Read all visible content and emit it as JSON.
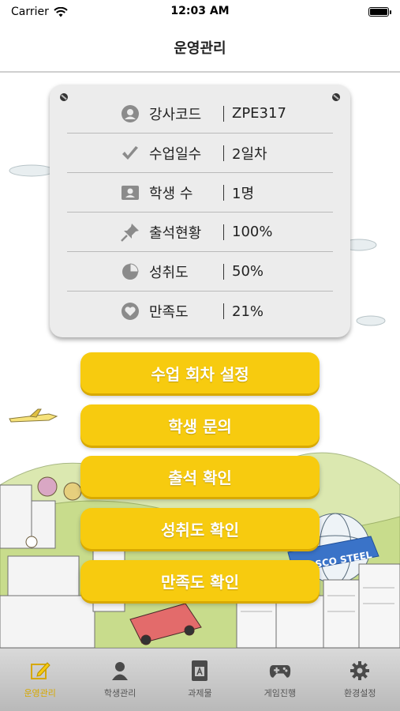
{
  "status_bar": {
    "carrier": "Carrier",
    "time": "12:03 AM"
  },
  "nav": {
    "title": "운영관리"
  },
  "info": {
    "rows": [
      {
        "label": "강사코드",
        "value": "ZPE317",
        "icon": "user-circle-icon"
      },
      {
        "label": "수업일수",
        "value": "2일차",
        "icon": "checkmark-icon"
      },
      {
        "label": "학생 수",
        "value": "1명",
        "icon": "id-card-icon"
      },
      {
        "label": "출석현황",
        "value": "100%",
        "icon": "pushpin-icon"
      },
      {
        "label": "성취도",
        "value": "50%",
        "icon": "pie-chart-icon"
      },
      {
        "label": "만족도",
        "value": "21%",
        "icon": "heart-circle-icon"
      }
    ]
  },
  "actions": {
    "session_settings": "수업 회차 설정",
    "student_inquiry": "학생 문의",
    "attendance_check": "출석 확인",
    "achievement_check": "성취도 확인",
    "satisfaction_check": "만족도 확인"
  },
  "scene": {
    "sign_text": "POSCO STEEL"
  },
  "tabs": [
    {
      "label": "운영관리",
      "icon": "pencil-icon",
      "active": true
    },
    {
      "label": "학생관리",
      "icon": "person-icon",
      "active": false
    },
    {
      "label": "과제물",
      "icon": "book-icon",
      "active": false
    },
    {
      "label": "게임진행",
      "icon": "gamepad-icon",
      "active": false
    },
    {
      "label": "환경설정",
      "icon": "gear-icon",
      "active": false
    }
  ],
  "colors": {
    "accent": "#f7cb0f",
    "active_tab": "#d6a800"
  }
}
